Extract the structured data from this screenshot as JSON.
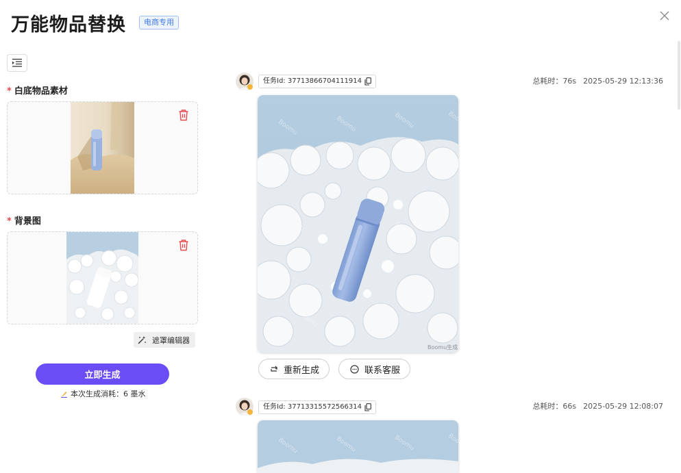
{
  "header": {
    "title": "万能物品替换",
    "badge": "电商专用"
  },
  "left_panel": {
    "object_section": {
      "label": "白底物品素材",
      "required_mark": "*"
    },
    "background_section": {
      "label": "背景图",
      "required_mark": "*"
    },
    "mask_editor_label": "遮罩编辑器",
    "generate_label": "立即生成",
    "cost_text": "本次生成消耗：6 墨水"
  },
  "tasks": [
    {
      "task_id": "任务Id: 37713866704111914",
      "elapsed": "总耗时：76s",
      "timestamp": "2025-05-29 12:13:36",
      "watermark": "Boomu生成",
      "actions": {
        "regenerate": "重新生成",
        "contact": "联系客服"
      }
    },
    {
      "task_id": "任务Id: 37713315572566314",
      "elapsed": "总耗时：66s",
      "timestamp": "2025-05-29 12:08:07"
    }
  ],
  "colors": {
    "accent": "#6b4df5",
    "badge_text": "#3f7ae6",
    "danger": "#e5484d",
    "sky": "#b7cfe3",
    "bottle": "#8aa6d8"
  },
  "icons": [
    "close-icon",
    "sidebar-toggle-icon",
    "delete-icon",
    "mask-wand-icon",
    "ink-icon",
    "copy-icon",
    "loop-icon",
    "chat-icon",
    "user-avatar"
  ]
}
